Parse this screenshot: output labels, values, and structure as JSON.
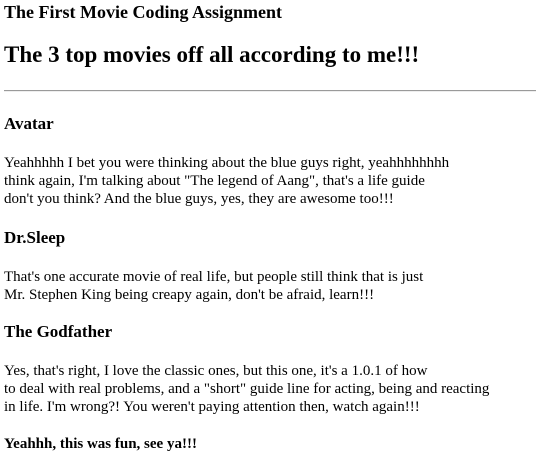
{
  "header": {
    "site_title": "The First Movie Coding Assignment",
    "main_title": "The 3 top movies off all according to me!!!"
  },
  "movies": [
    {
      "title": "Avatar",
      "text": "Yeahhhhh I bet you were thinking about the blue guys right, yeahhhhhhhh\nthink again, I'm talking about \"The legend of Aang\", that's a life guide\ndon't you think? And the blue guys, yes, they are awesome too!!!"
    },
    {
      "title": "Dr.Sleep",
      "text": "That's one accurate movie of real life, but people still think that is just\nMr. Stephen King being creapy again, don't be afraid, learn!!!"
    },
    {
      "title": "The Godfather",
      "text": "Yes, that's right, I love the classic ones, but this one, it's a 1.0.1 of how\nto deal with real problems, and a \"short\" guide line for acting, being and reacting\nin life. I'm wrong?! You weren't paying attention then, watch again!!!"
    }
  ],
  "footer": {
    "closing_text": "Yeahhh, this was fun, see ya!!!"
  }
}
